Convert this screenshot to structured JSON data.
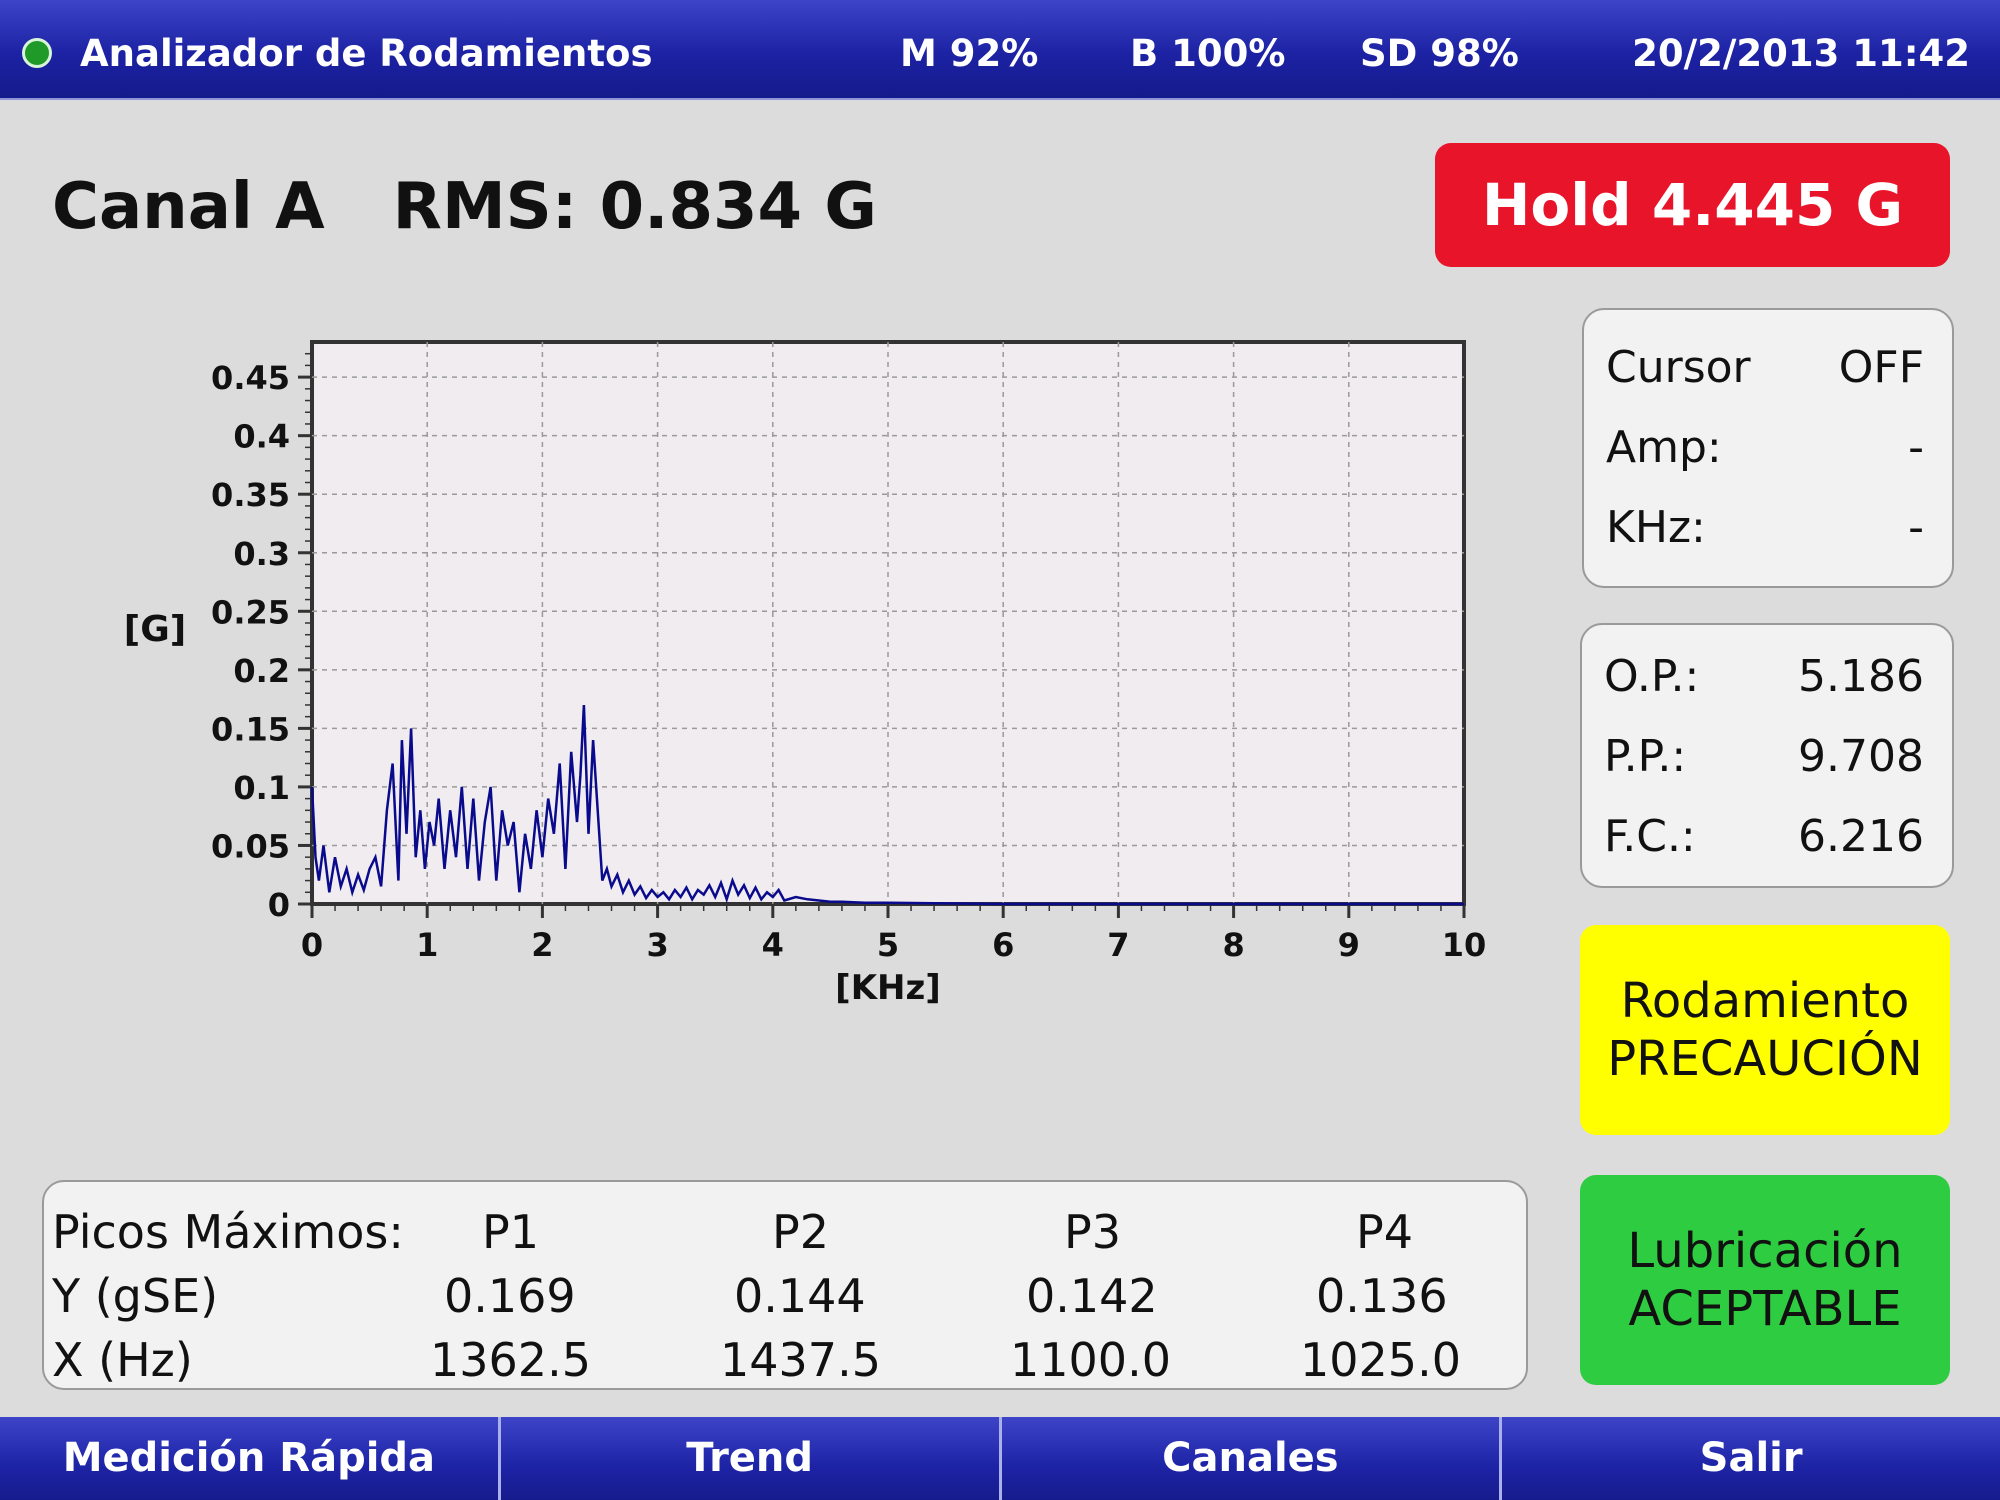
{
  "header": {
    "title": "Analizador de Rodamientos",
    "memory": "M 92%",
    "battery": "B 100%",
    "sd": "SD 98%",
    "datetime": "20/2/2013 11:42",
    "status_color": "#1f9a28"
  },
  "measurement": {
    "channel": "Canal A",
    "rms": "RMS: 0.834 G",
    "hold": "Hold 4.445 G"
  },
  "cursor_panel": {
    "rows": [
      {
        "label": "Cursor",
        "value": "OFF"
      },
      {
        "label": "Amp:",
        "value": "-"
      },
      {
        "label": "KHz:",
        "value": "-"
      }
    ]
  },
  "stats_panel": {
    "rows": [
      {
        "label": "O.P.:",
        "value": "5.186"
      },
      {
        "label": "P.P.:",
        "value": "9.708"
      },
      {
        "label": "F.C.:",
        "value": "6.216"
      }
    ]
  },
  "bearing_status": {
    "line1": "Rodamiento",
    "line2": "PRECAUCIÓN",
    "color": "#ffff00"
  },
  "lubrication_status": {
    "line1": "Lubricación",
    "line2": "ACEPTABLE",
    "color": "#2ecc40"
  },
  "peaks": {
    "title": "Picos Máximos:",
    "columns": [
      "P1",
      "P2",
      "P3",
      "P4"
    ],
    "y_label": "Y (gSE)",
    "y_values": [
      "0.169",
      "0.144",
      "0.142",
      "0.136"
    ],
    "x_label": "X (Hz)",
    "x_values": [
      "1362.5",
      "1437.5",
      "1100.0",
      "1025.0"
    ]
  },
  "bottom_nav": {
    "items": [
      "Medición Rápida",
      "Trend",
      "Canales",
      "Salir"
    ]
  },
  "chart_data": {
    "type": "line",
    "xlabel": "[KHz]",
    "ylabel": "[G]",
    "xlim": [
      0,
      10
    ],
    "ylim": [
      0,
      0.48
    ],
    "x_ticks": [
      "0",
      "1",
      "2",
      "3",
      "4",
      "5",
      "6",
      "7",
      "8",
      "9",
      "10"
    ],
    "y_ticks": [
      "0",
      "0.05",
      "0.1",
      "0.15",
      "0.2",
      "0.25",
      "0.3",
      "0.35",
      "0.4",
      "0.45"
    ],
    "grid": true,
    "line_color": "#0a0a8c",
    "series": [
      {
        "x": [
          0.0,
          0.03,
          0.06,
          0.1,
          0.15,
          0.2,
          0.25,
          0.3,
          0.35,
          0.4,
          0.45,
          0.5,
          0.55,
          0.6,
          0.65,
          0.7,
          0.75,
          0.78,
          0.82,
          0.86,
          0.9,
          0.94,
          0.98,
          1.02,
          1.06,
          1.1,
          1.15,
          1.2,
          1.25,
          1.3,
          1.35,
          1.4,
          1.45,
          1.5,
          1.55,
          1.6,
          1.65,
          1.7,
          1.75,
          1.8,
          1.85,
          1.9,
          1.95,
          2.0,
          2.05,
          2.1,
          2.15,
          2.2,
          2.25,
          2.3,
          2.33,
          2.36,
          2.4,
          2.44,
          2.48,
          2.52,
          2.56,
          2.6,
          2.65,
          2.7,
          2.75,
          2.8,
          2.85,
          2.9,
          2.95,
          3.0,
          3.05,
          3.1,
          3.15,
          3.2,
          3.25,
          3.3,
          3.35,
          3.4,
          3.45,
          3.5,
          3.55,
          3.6,
          3.65,
          3.7,
          3.75,
          3.8,
          3.85,
          3.9,
          3.95,
          4.0,
          4.05,
          4.1,
          4.2,
          4.3,
          4.4,
          4.5,
          4.6,
          4.8,
          5.0,
          5.5,
          6.0,
          7.0,
          8.0,
          9.0,
          10.0
        ],
        "y": [
          0.1,
          0.04,
          0.02,
          0.05,
          0.01,
          0.04,
          0.015,
          0.03,
          0.01,
          0.025,
          0.012,
          0.03,
          0.04,
          0.015,
          0.08,
          0.12,
          0.02,
          0.14,
          0.06,
          0.15,
          0.04,
          0.08,
          0.03,
          0.07,
          0.05,
          0.09,
          0.03,
          0.08,
          0.04,
          0.1,
          0.03,
          0.09,
          0.02,
          0.07,
          0.1,
          0.02,
          0.08,
          0.05,
          0.07,
          0.01,
          0.06,
          0.03,
          0.08,
          0.04,
          0.09,
          0.06,
          0.12,
          0.03,
          0.13,
          0.07,
          0.11,
          0.17,
          0.06,
          0.14,
          0.08,
          0.02,
          0.03,
          0.015,
          0.025,
          0.01,
          0.02,
          0.008,
          0.015,
          0.005,
          0.012,
          0.006,
          0.01,
          0.004,
          0.012,
          0.006,
          0.014,
          0.004,
          0.012,
          0.008,
          0.016,
          0.006,
          0.018,
          0.004,
          0.02,
          0.008,
          0.016,
          0.005,
          0.014,
          0.004,
          0.01,
          0.006,
          0.012,
          0.003,
          0.006,
          0.004,
          0.003,
          0.002,
          0.002,
          0.001,
          0.001,
          0.0005,
          0.0,
          0.0,
          0.0,
          0.0,
          0.0
        ]
      }
    ]
  }
}
